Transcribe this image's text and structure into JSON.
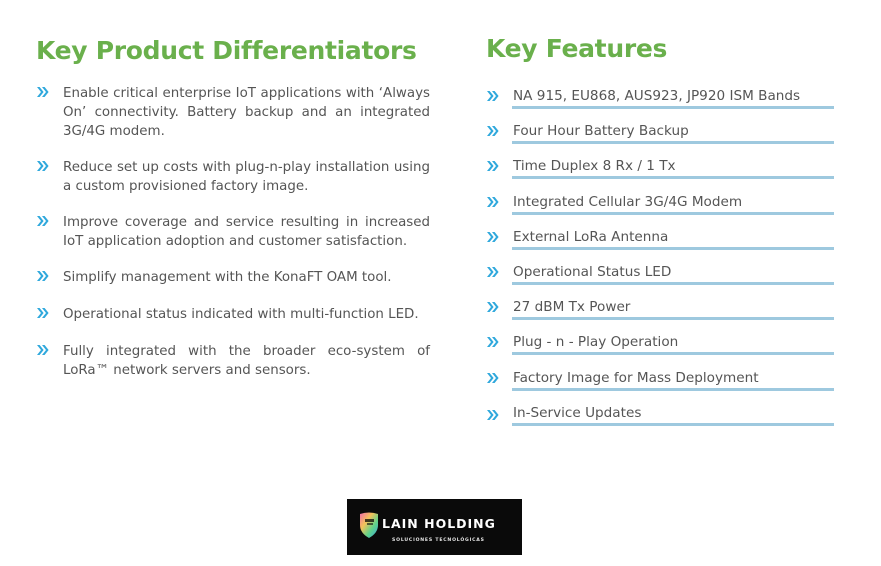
{
  "colors": {
    "heading": "#6ab04c",
    "bullet": "#2fa8dc",
    "rule": "#9ec9df",
    "body_text": "#555555",
    "logo_bg": "#0a0a0a"
  },
  "differentiators": {
    "title": "Key Product Differentiators",
    "bullet_icon": "double-chevron-right-icon",
    "items": [
      {
        "text": "Enable critical enterprise IoT applications with ‘Always On’ connectivity.  Battery backup and an integrated 3G/4G modem."
      },
      {
        "text": "Reduce set up costs with plug-n-play installation using a custom provisioned factory image."
      },
      {
        "text": "Improve coverage and service resulting in increased IoT application adoption and customer satisfaction."
      },
      {
        "text": "Simplify management with the KonaFT OAM tool."
      },
      {
        "text": "Operational status indicated with multi-function LED."
      },
      {
        "text": "Fully integrated with the broader eco-system of LoRa™ network servers and sensors."
      }
    ]
  },
  "features": {
    "title": "Key Features",
    "bullet_icon": "double-chevron-right-icon",
    "items": [
      {
        "text": "NA 915, EU868, AUS923, JP920 ISM Bands"
      },
      {
        "text": "Four Hour Battery Backup"
      },
      {
        "text": "Time Duplex 8 Rx / 1 Tx"
      },
      {
        "text": "Integrated Cellular 3G/4G Modem"
      },
      {
        "text": "External LoRa Antenna"
      },
      {
        "text": "Operational Status LED"
      },
      {
        "text": "27 dBM Tx Power"
      },
      {
        "text": "Plug - n - Play Operation"
      },
      {
        "text": "Factory Image for Mass Deployment"
      },
      {
        "text": "In-Service Updates"
      }
    ]
  },
  "logo": {
    "brand": "LAIN HOLDING",
    "tagline": "SOLUCIONES TECNOLÓGICAS",
    "icon": "shield-icon"
  }
}
